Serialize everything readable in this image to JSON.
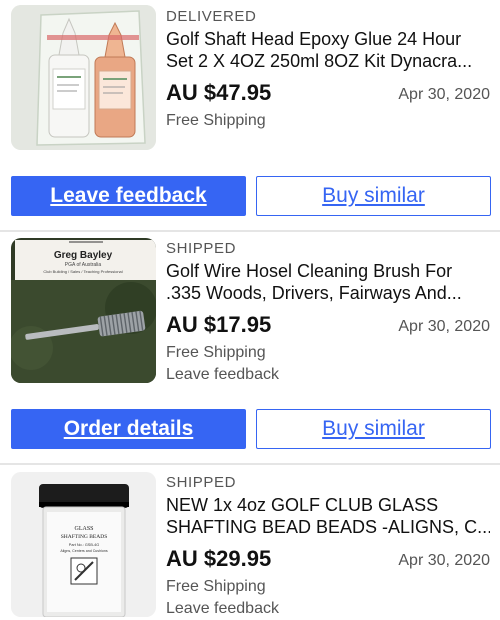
{
  "orders": [
    {
      "status": "DELIVERED",
      "title_line1": "Golf Shaft Head Epoxy Glue 24 Hour",
      "title_line2": "Set 2 X 4OZ 250ml 8OZ Kit Dynacra...",
      "price": "AU $47.95",
      "date": "Apr 30, 2020",
      "shipping": "Free Shipping",
      "image_icon": "epoxy-bottles-image"
    },
    {
      "status": "SHIPPED",
      "title_line1": "Golf Wire Hosel Cleaning Brush For",
      "title_line2": ".335 Woods, Drivers, Fairways And...",
      "price": "AU $17.95",
      "date": "Apr 30, 2020",
      "shipping": "Free Shipping",
      "feedback_link": "Leave feedback",
      "image_text": {
        "name": "Greg Bayley",
        "subtitle": "PGA of Australia",
        "line": "Club Building / Sales / Teaching Professional"
      }
    },
    {
      "status": "SHIPPED",
      "title_line1": "NEW 1x 4oz GOLF CLUB GLASS",
      "title_line2": "SHAFTING BEAD BEADS -ALIGNS, C...",
      "price": "AU $29.95",
      "date": "Apr 30, 2020",
      "shipping": "Free Shipping",
      "feedback_link": "Leave feedback",
      "image_text": {
        "line1": "GLASS",
        "line2": "SHAFTING BEADS",
        "line3": "Part No.: GSB-4G",
        "line4": "Aligns, Centers and Cushions"
      }
    }
  ],
  "actions": [
    {
      "primary": "Leave feedback",
      "secondary": "Buy similar"
    },
    {
      "primary": "Order details",
      "secondary": "Buy similar"
    }
  ],
  "colors": {
    "accent": "#3665f3",
    "muted_text": "#555555",
    "divider": "#e5e5e5"
  }
}
